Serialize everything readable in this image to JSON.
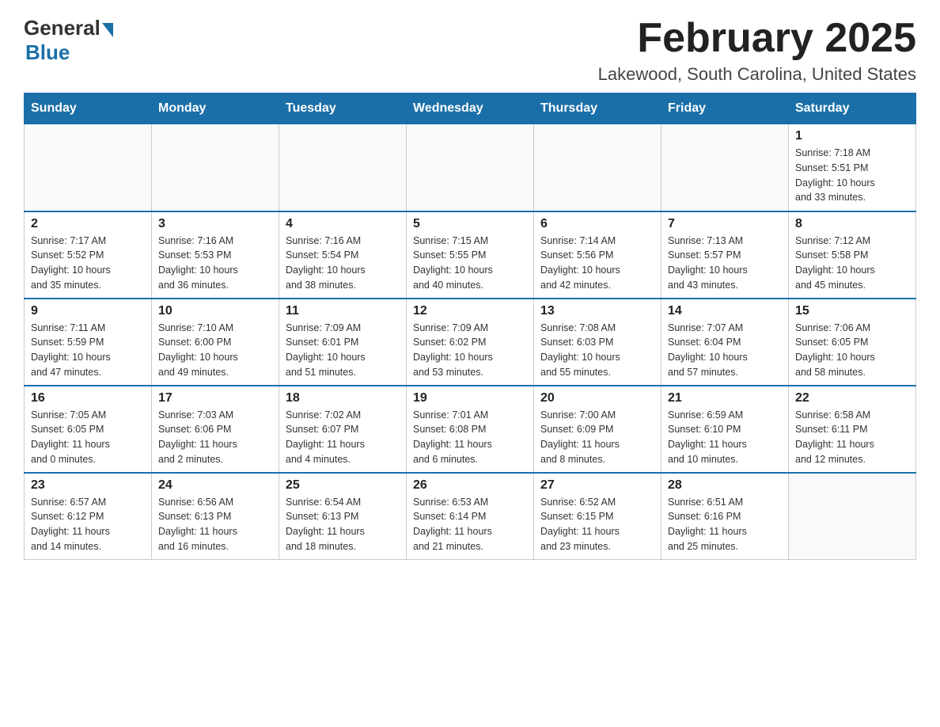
{
  "logo": {
    "general": "General",
    "blue": "Blue"
  },
  "title": "February 2025",
  "location": "Lakewood, South Carolina, United States",
  "days_header": [
    "Sunday",
    "Monday",
    "Tuesday",
    "Wednesday",
    "Thursday",
    "Friday",
    "Saturday"
  ],
  "weeks": [
    [
      {
        "day": "",
        "info": ""
      },
      {
        "day": "",
        "info": ""
      },
      {
        "day": "",
        "info": ""
      },
      {
        "day": "",
        "info": ""
      },
      {
        "day": "",
        "info": ""
      },
      {
        "day": "",
        "info": ""
      },
      {
        "day": "1",
        "info": "Sunrise: 7:18 AM\nSunset: 5:51 PM\nDaylight: 10 hours\nand 33 minutes."
      }
    ],
    [
      {
        "day": "2",
        "info": "Sunrise: 7:17 AM\nSunset: 5:52 PM\nDaylight: 10 hours\nand 35 minutes."
      },
      {
        "day": "3",
        "info": "Sunrise: 7:16 AM\nSunset: 5:53 PM\nDaylight: 10 hours\nand 36 minutes."
      },
      {
        "day": "4",
        "info": "Sunrise: 7:16 AM\nSunset: 5:54 PM\nDaylight: 10 hours\nand 38 minutes."
      },
      {
        "day": "5",
        "info": "Sunrise: 7:15 AM\nSunset: 5:55 PM\nDaylight: 10 hours\nand 40 minutes."
      },
      {
        "day": "6",
        "info": "Sunrise: 7:14 AM\nSunset: 5:56 PM\nDaylight: 10 hours\nand 42 minutes."
      },
      {
        "day": "7",
        "info": "Sunrise: 7:13 AM\nSunset: 5:57 PM\nDaylight: 10 hours\nand 43 minutes."
      },
      {
        "day": "8",
        "info": "Sunrise: 7:12 AM\nSunset: 5:58 PM\nDaylight: 10 hours\nand 45 minutes."
      }
    ],
    [
      {
        "day": "9",
        "info": "Sunrise: 7:11 AM\nSunset: 5:59 PM\nDaylight: 10 hours\nand 47 minutes."
      },
      {
        "day": "10",
        "info": "Sunrise: 7:10 AM\nSunset: 6:00 PM\nDaylight: 10 hours\nand 49 minutes."
      },
      {
        "day": "11",
        "info": "Sunrise: 7:09 AM\nSunset: 6:01 PM\nDaylight: 10 hours\nand 51 minutes."
      },
      {
        "day": "12",
        "info": "Sunrise: 7:09 AM\nSunset: 6:02 PM\nDaylight: 10 hours\nand 53 minutes."
      },
      {
        "day": "13",
        "info": "Sunrise: 7:08 AM\nSunset: 6:03 PM\nDaylight: 10 hours\nand 55 minutes."
      },
      {
        "day": "14",
        "info": "Sunrise: 7:07 AM\nSunset: 6:04 PM\nDaylight: 10 hours\nand 57 minutes."
      },
      {
        "day": "15",
        "info": "Sunrise: 7:06 AM\nSunset: 6:05 PM\nDaylight: 10 hours\nand 58 minutes."
      }
    ],
    [
      {
        "day": "16",
        "info": "Sunrise: 7:05 AM\nSunset: 6:05 PM\nDaylight: 11 hours\nand 0 minutes."
      },
      {
        "day": "17",
        "info": "Sunrise: 7:03 AM\nSunset: 6:06 PM\nDaylight: 11 hours\nand 2 minutes."
      },
      {
        "day": "18",
        "info": "Sunrise: 7:02 AM\nSunset: 6:07 PM\nDaylight: 11 hours\nand 4 minutes."
      },
      {
        "day": "19",
        "info": "Sunrise: 7:01 AM\nSunset: 6:08 PM\nDaylight: 11 hours\nand 6 minutes."
      },
      {
        "day": "20",
        "info": "Sunrise: 7:00 AM\nSunset: 6:09 PM\nDaylight: 11 hours\nand 8 minutes."
      },
      {
        "day": "21",
        "info": "Sunrise: 6:59 AM\nSunset: 6:10 PM\nDaylight: 11 hours\nand 10 minutes."
      },
      {
        "day": "22",
        "info": "Sunrise: 6:58 AM\nSunset: 6:11 PM\nDaylight: 11 hours\nand 12 minutes."
      }
    ],
    [
      {
        "day": "23",
        "info": "Sunrise: 6:57 AM\nSunset: 6:12 PM\nDaylight: 11 hours\nand 14 minutes."
      },
      {
        "day": "24",
        "info": "Sunrise: 6:56 AM\nSunset: 6:13 PM\nDaylight: 11 hours\nand 16 minutes."
      },
      {
        "day": "25",
        "info": "Sunrise: 6:54 AM\nSunset: 6:13 PM\nDaylight: 11 hours\nand 18 minutes."
      },
      {
        "day": "26",
        "info": "Sunrise: 6:53 AM\nSunset: 6:14 PM\nDaylight: 11 hours\nand 21 minutes."
      },
      {
        "day": "27",
        "info": "Sunrise: 6:52 AM\nSunset: 6:15 PM\nDaylight: 11 hours\nand 23 minutes."
      },
      {
        "day": "28",
        "info": "Sunrise: 6:51 AM\nSunset: 6:16 PM\nDaylight: 11 hours\nand 25 minutes."
      },
      {
        "day": "",
        "info": ""
      }
    ]
  ]
}
